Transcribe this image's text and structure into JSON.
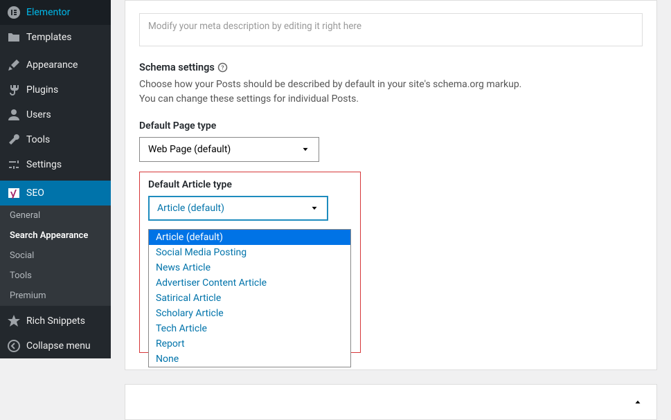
{
  "sidebar": {
    "items": [
      {
        "label": "Elementor"
      },
      {
        "label": "Templates"
      },
      {
        "label": "Appearance"
      },
      {
        "label": "Plugins"
      },
      {
        "label": "Users"
      },
      {
        "label": "Tools"
      },
      {
        "label": "Settings"
      },
      {
        "label": "SEO"
      },
      {
        "label": "Rich Snippets"
      },
      {
        "label": "Collapse menu"
      }
    ],
    "seo_sub": [
      {
        "label": "General"
      },
      {
        "label": "Search Appearance"
      },
      {
        "label": "Social"
      },
      {
        "label": "Tools"
      },
      {
        "label": "Premium"
      }
    ]
  },
  "meta_placeholder": "Modify your meta description by editing it right here",
  "schema": {
    "title": "Schema settings",
    "desc": "Choose how your Posts should be described by default in your site's schema.org markup. You can change these settings for individual Posts."
  },
  "page_type": {
    "label": "Default Page type",
    "value": "Web Page (default)"
  },
  "article_type": {
    "label": "Default Article type",
    "value": "Article (default)",
    "options": [
      "Article (default)",
      "Social Media Posting",
      "News Article",
      "Advertiser Content Article",
      "Satirical Article",
      "Scholary Article",
      "Tech Article",
      "Report",
      "None"
    ]
  }
}
